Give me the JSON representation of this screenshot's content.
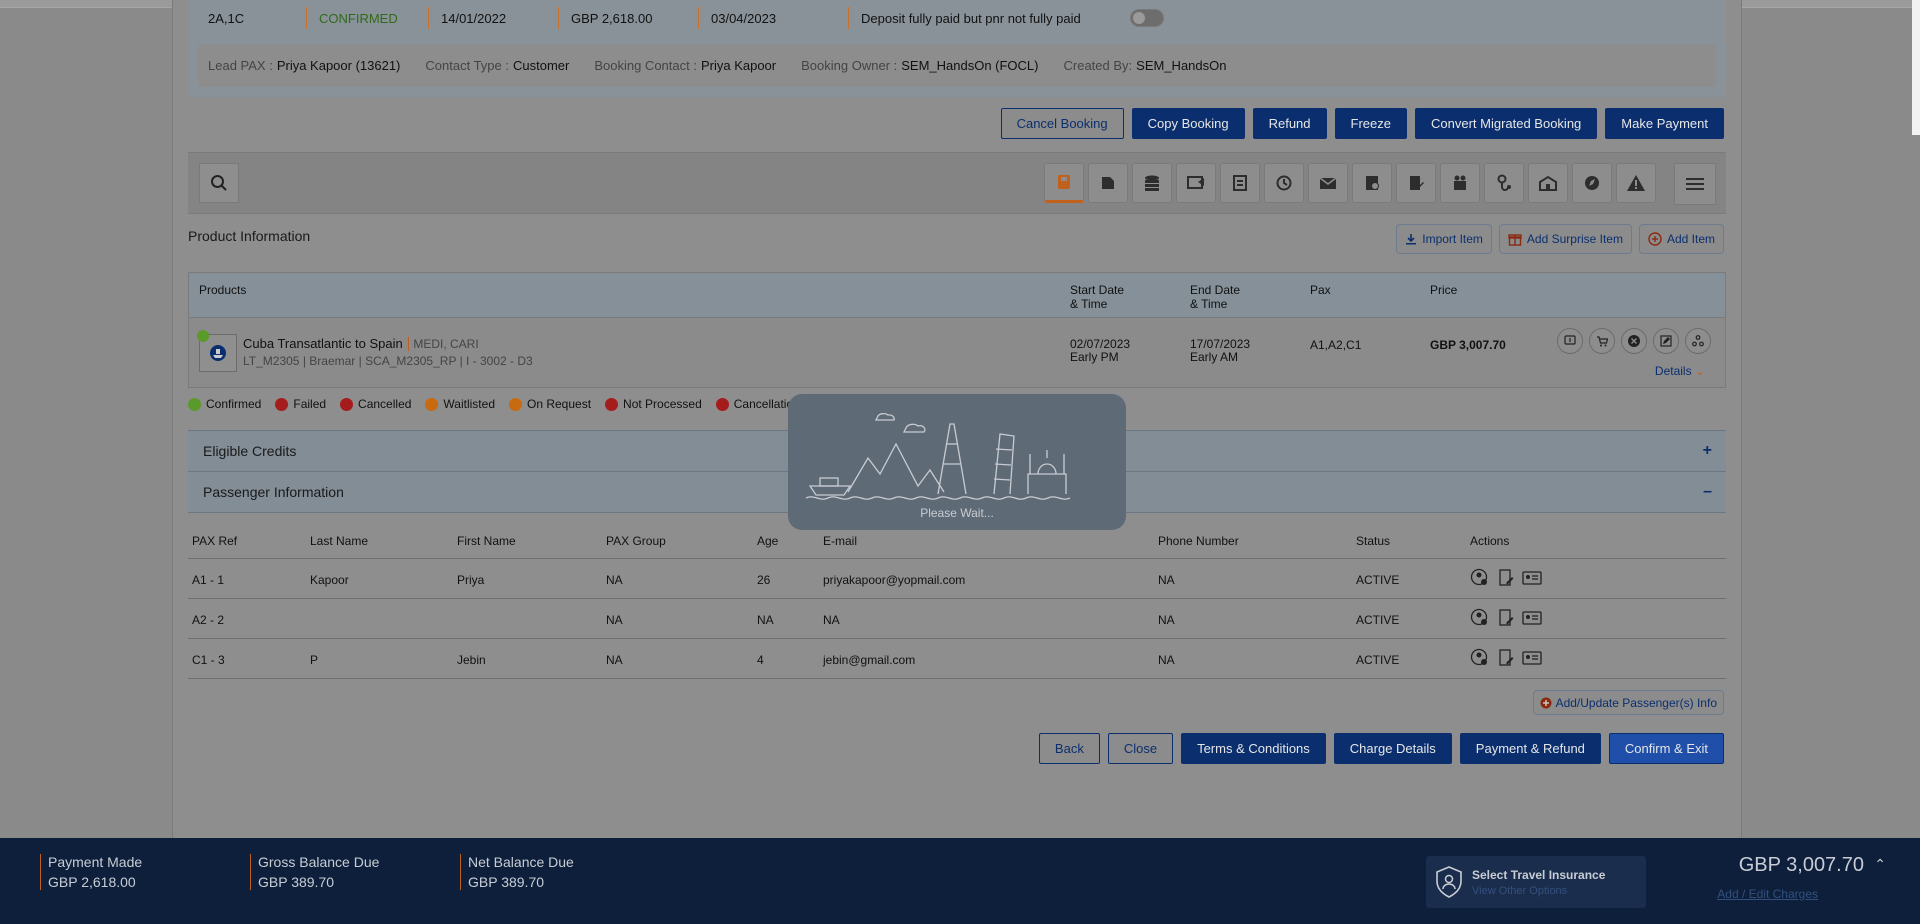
{
  "summary": {
    "pax": "2A,1C",
    "status": "CONFIRMED",
    "booking_date": "14/01/2022",
    "amount": "GBP 2,618.00",
    "travel_date": "03/04/2023",
    "payment_note": "Deposit fully paid but pnr not fully paid"
  },
  "lead": {
    "lead_pax_label": "Lead PAX :",
    "lead_pax": "Priya Kapoor (13621)",
    "contact_type_label": "Contact Type :",
    "contact_type": "Customer",
    "booking_contact_label": "Booking Contact :",
    "booking_contact": "Priya Kapoor",
    "booking_owner_label": "Booking Owner :",
    "booking_owner": "SEM_HandsOn (FOCL)",
    "created_by_label": "Created By:",
    "created_by": "SEM_HandsOn"
  },
  "actions": {
    "cancel": "Cancel Booking",
    "copy": "Copy Booking",
    "refund": "Refund",
    "freeze": "Freeze",
    "convert": "Convert Migrated Booking",
    "payment": "Make Payment"
  },
  "icons": {
    "search": "search-icon",
    "toolbar": [
      "itinerary-icon",
      "documents-icon",
      "payments-icon",
      "send-icon",
      "notes-icon",
      "history-icon",
      "email-icon",
      "invoice-icon",
      "edit-doc-icon",
      "passengers-icon",
      "medical-icon",
      "hotel-icon",
      "compass-icon",
      "warning-icon"
    ],
    "menu": "hamburger-icon"
  },
  "product": {
    "title": "Product Information",
    "import": "Import Item",
    "surprise": "Add Surprise Item",
    "add": "Add Item",
    "headers": {
      "products": "Products",
      "start": "Start Date",
      "start2": "& Time",
      "end": "End Date",
      "end2": "& Time",
      "pax": "Pax",
      "price": "Price"
    },
    "row": {
      "name": "Cuba Transatlantic to Spain",
      "region": "MEDI, CARI",
      "codes": "LT_M2305 | Braemar | SCA_M2305_RP | I - 3002 - D3",
      "start_date": "02/07/2023",
      "start_time": "Early PM",
      "end_date": "17/07/2023",
      "end_time": "Early AM",
      "pax": "A1,A2,C1",
      "price": "GBP 3,007.70",
      "details": "Details"
    }
  },
  "legend": [
    "Confirmed",
    "Failed",
    "Cancelled",
    "Waitlisted",
    "On Request",
    "Not Processed",
    "Cancellation Failed"
  ],
  "colors": {
    "brand": "#0b2f6e",
    "accent": "#c0611d",
    "confirmed": "#5a9a2a",
    "failed": "#a51c1c",
    "waitlisted": "#c76a10"
  },
  "accordions": {
    "credits": "Eligible Credits",
    "passengers": "Passenger Information"
  },
  "pax_table": {
    "headers": [
      "PAX Ref",
      "Last Name",
      "First Name",
      "PAX Group",
      "Age",
      "E-mail",
      "Phone Number",
      "Status",
      "Actions"
    ],
    "rows": [
      [
        "A1 - 1",
        "Kapoor",
        "Priya",
        "NA",
        "26",
        "priyakapoor@yopmail.com",
        "NA",
        "ACTIVE"
      ],
      [
        "A2 - 2",
        "",
        "",
        "NA",
        "NA",
        "NA",
        "NA",
        "ACTIVE"
      ],
      [
        "C1 - 3",
        "P",
        "Jebin",
        "NA",
        "4",
        "jebin@gmail.com",
        "NA",
        "ACTIVE"
      ]
    ],
    "add_update": "Add/Update Passenger(s) Info"
  },
  "bottom": {
    "back": "Back",
    "close": "Close",
    "terms": "Terms & Conditions",
    "charge": "Charge Details",
    "payrefund": "Payment & Refund",
    "confirm": "Confirm & Exit"
  },
  "loading": {
    "text": "Please Wait..."
  },
  "footer": {
    "paid_label": "Payment Made",
    "paid": "GBP 2,618.00",
    "gross_label": "Gross Balance Due",
    "gross": "GBP 389.70",
    "net_label": "Net Balance Due",
    "net": "GBP 389.70",
    "insurance_title": "Select Travel Insurance",
    "insurance_sub": "View Other Options",
    "total": "GBP 3,007.70",
    "edit_charges": "Add / Edit Charges"
  }
}
